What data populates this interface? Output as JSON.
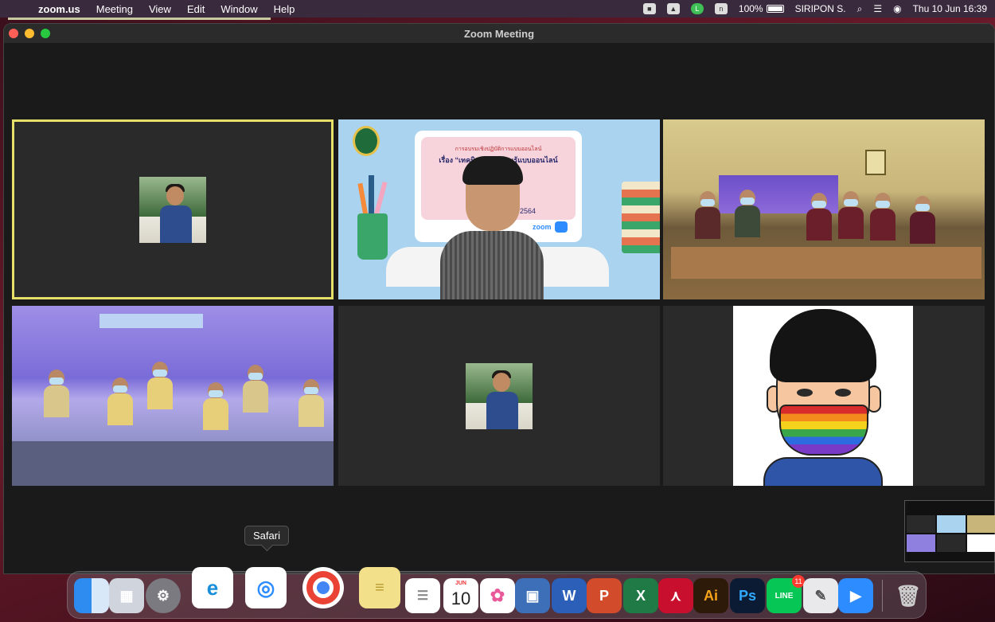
{
  "menubar": {
    "app_name": "zoom.us",
    "menus": [
      "Meeting",
      "View",
      "Edit",
      "Window",
      "Help"
    ],
    "battery": "100%",
    "user": "SIRIPON S.",
    "datetime": "Thu 10 Jun  16:39"
  },
  "window": {
    "title": "Zoom Meeting"
  },
  "slide": {
    "line1": "การอบรมเชิงปฏิบัติการแบบออนไลน์",
    "line2": "เรื่อง “เทคนิค...การเรียนรู้แบบออนไลน์",
    "year": "2564",
    "brand": "zoom"
  },
  "tooltip": {
    "label": "Safari"
  },
  "dock": {
    "calendar_month": "JUN",
    "calendar_day": "10",
    "line_badge": "11",
    "ai_label": "Ai",
    "ps_label": "Ps",
    "line_label": "LINE"
  },
  "colors": {
    "active_speaker_outline": "#e6e06a",
    "zoom_blue": "#2d8cff"
  }
}
